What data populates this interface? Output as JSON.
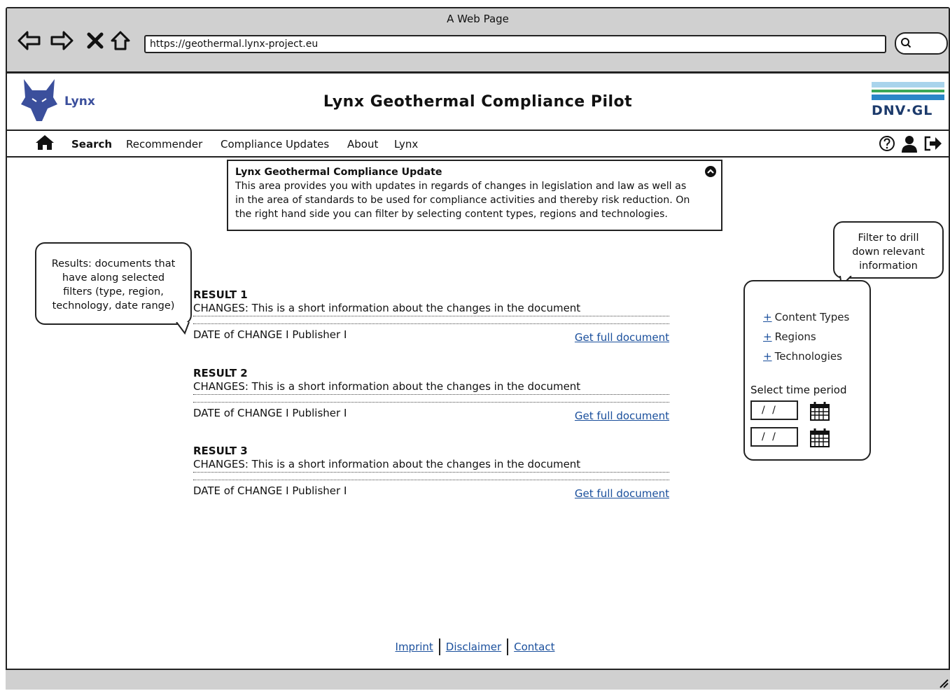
{
  "window": {
    "title": "A Web Page",
    "url": "https://geothermal.lynx-project.eu"
  },
  "header": {
    "logo_text": "Lynx",
    "site_title": "Lynx Geothermal Compliance Pilot",
    "partner_logo": "DNV·GL"
  },
  "menu": {
    "items": [
      {
        "label": "Search",
        "active": true
      },
      {
        "label": "Recommender"
      },
      {
        "label": "Compliance Updates"
      },
      {
        "label": "About"
      },
      {
        "label": "Lynx"
      }
    ]
  },
  "info": {
    "title": "Lynx Geothermal Compliance Update",
    "lines": [
      "This area provides you with updates in regards of changes in legislation and law as well as",
      "in the area of standards to be used for compliance activities and thereby risk reduction. On",
      "the right hand side you can filter by selecting content types, regions and technologies."
    ]
  },
  "callouts": {
    "results": [
      "Results: documents that",
      "have along selected",
      "filters (type, region,",
      "technology, date range)"
    ],
    "filter": [
      "Filter to drill",
      "down relevant",
      "information"
    ]
  },
  "results": [
    {
      "title": "RESULT 1",
      "changes": "CHANGES: This is a short information about the changes in the document",
      "meta": "DATE of CHANGE I Publisher I",
      "link": "Get full document"
    },
    {
      "title": "RESULT 2",
      "changes": "CHANGES: This is a short information about the changes in the document",
      "meta": "DATE of CHANGE I Publisher I",
      "link": "Get full document"
    },
    {
      "title": "RESULT 3",
      "changes": "CHANGES: This is a short information about the changes in the document",
      "meta": "DATE of CHANGE I Publisher I",
      "link": "Get full document"
    }
  ],
  "filters": {
    "plus": "+",
    "items": [
      "Content Types",
      "Regions",
      "Technologies"
    ],
    "time_label": "Select time period",
    "date_placeholder": "/ /"
  },
  "footer": {
    "links": [
      "Imprint",
      "Disclaimer",
      "Contact"
    ]
  },
  "colors": {
    "link": "#1a4f9c",
    "logo_blue": "#3b4f9c",
    "chrome_gray": "#d0d0d0"
  }
}
